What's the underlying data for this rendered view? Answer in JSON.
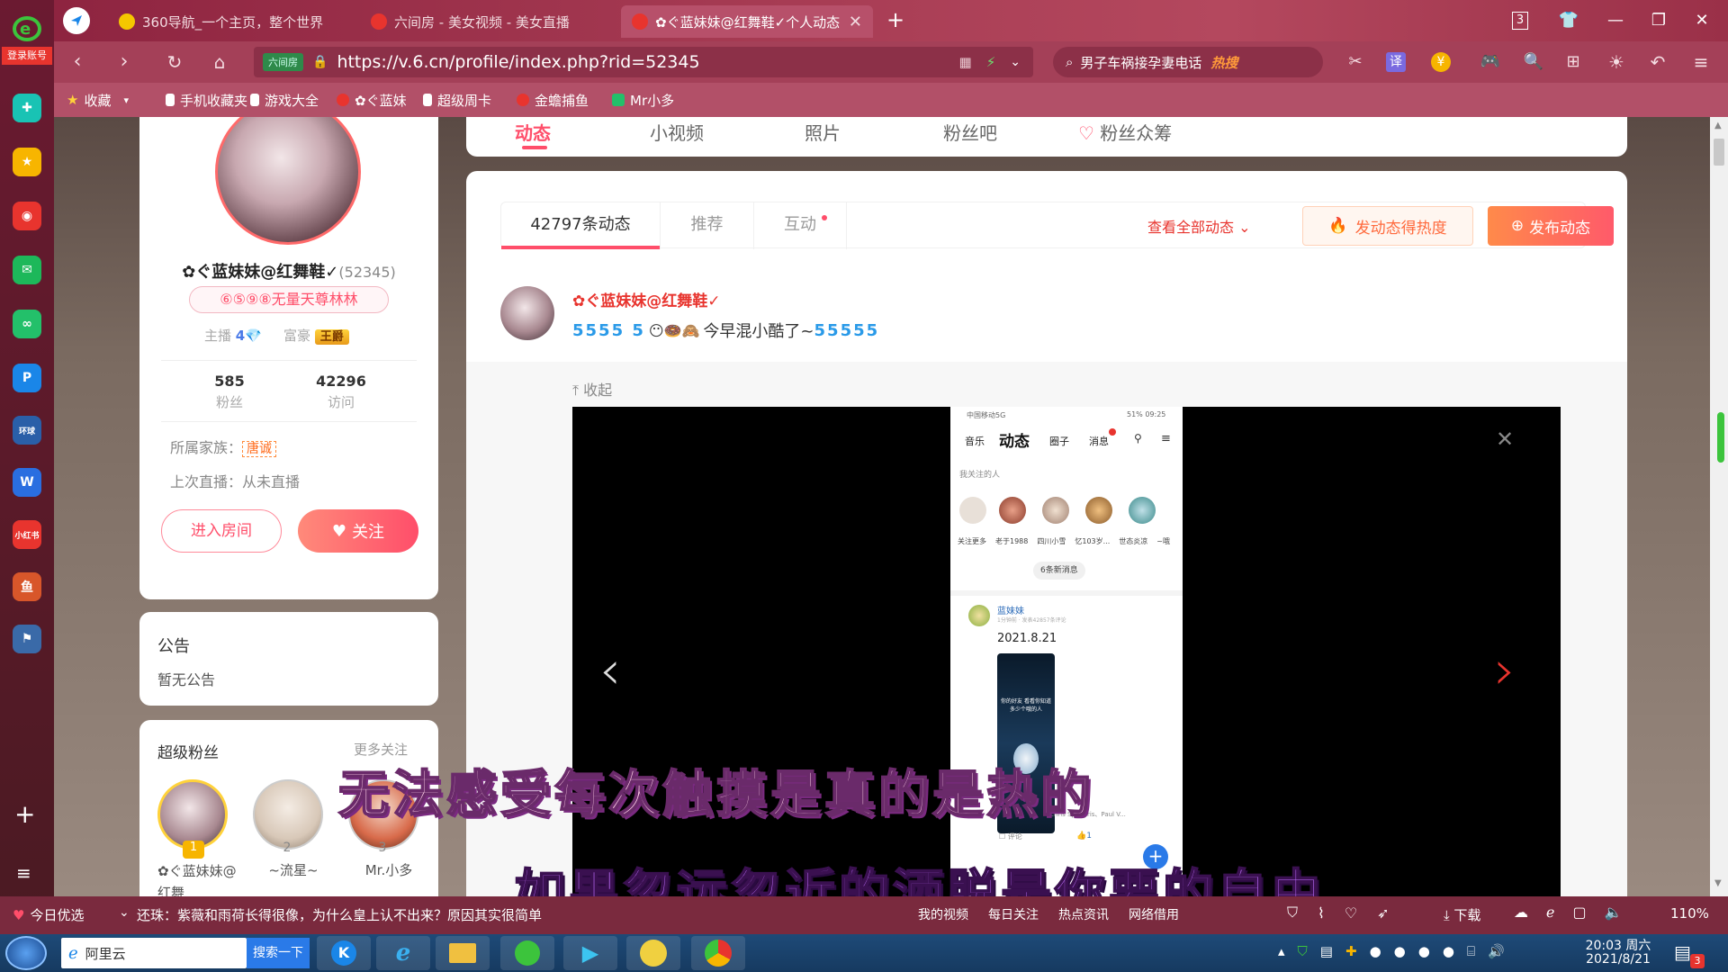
{
  "browser": {
    "login_label": "登录账号",
    "tabs": [
      {
        "label": "360导航_一个主页，整个世界",
        "active": false
      },
      {
        "label": "六间房 - 美女视频 - 美女直播",
        "active": false
      },
      {
        "label": "✿ぐ蓝妹妹@红舞鞋✓个人动态",
        "active": true
      }
    ],
    "tab_count": "3",
    "address_badge": "六间房",
    "url": "https://v.6.cn/profile/index.php?rid=52345",
    "search_text": "男子车祸接孕妻电话",
    "search_hot": "热搜",
    "translate_label": "译",
    "bookmarks": [
      "收藏",
      "手机收藏夹",
      "游戏大全",
      "✿ぐ蓝妹",
      "超级周卡",
      "金蟾捕鱼",
      "Mr小多"
    ]
  },
  "profile_tabs": [
    "动态",
    "小视频",
    "照片",
    "粉丝吧",
    "粉丝众筹"
  ],
  "profile": {
    "name": "✿ぐ蓝妹妹@红舞鞋✓",
    "rid": "(52345)",
    "badge": "⑥⑤⑨⑧无量天尊林林",
    "anchor_label": "主播",
    "anchor_level": "4",
    "rich_label": "富豪",
    "rich_level": "王爵",
    "fans_count": "585",
    "fans_label": "粉丝",
    "visits_count": "42296",
    "visits_label": "访问",
    "family_label": "所属家族：",
    "family_value": "唐诚",
    "last_live": "上次直播：从未直播",
    "enter_room": "进入房间",
    "follow": "关注"
  },
  "notice": {
    "title": "公告",
    "text": "暂无公告"
  },
  "superfans": {
    "title": "超级粉丝",
    "more": "更多关注",
    "fans": [
      {
        "rank": "1",
        "name": "✿ぐ蓝妹妹@红舞"
      },
      {
        "rank": "2",
        "name": "~流星~"
      },
      {
        "rank": "3",
        "name": "Mr.小多"
      }
    ]
  },
  "feed": {
    "tabs": [
      "42797条动态",
      "推荐",
      "互动"
    ],
    "view_all": "查看全部动态",
    "hot_button": "发动态得热度",
    "publish_button": "发布动态",
    "post_author": "✿ぐ蓝妹妹@红舞鞋✓",
    "post_text": "今早混小酷了~",
    "collapse": "收起"
  },
  "phone": {
    "status_left": "中国移动5G",
    "status_right": "51% 09:25",
    "tabs": [
      "音乐",
      "动态",
      "圈子",
      "消息"
    ],
    "following_label": "我关注的人",
    "following": [
      "关注更多",
      "老于1988",
      "四川小雪",
      "忆103岁...",
      "世态炎凉",
      "~哦"
    ],
    "new_msg": "6条新消息",
    "post_name": "蓝妹妹",
    "post_meta": "1分钟前 · 发表42857条评论",
    "post_date": "2021.8.21",
    "video_caption": "你的好友 看看你知道多少个哦的人",
    "music": "Chris Spheeris、Paul V...",
    "comment": "评论",
    "likes": "1"
  },
  "subtitles": [
    "无法感受每次触摸是真的是热的",
    "如果忽远忽近的洒脱是你要的自由"
  ],
  "statusbar": {
    "today": "今日优选",
    "news": "还珠：紫薇和雨荷长得很像，为什么皇上认不出来？原因其实很简单",
    "items": [
      "我的视频",
      "每日关注",
      "热点资讯",
      "网络借用"
    ],
    "download": "下载",
    "zoom": "110%"
  },
  "taskbar": {
    "app_label": "阿里云",
    "search_btn": "搜索一下",
    "time": "20:03 周六",
    "date": "2021/8/21",
    "badge": "3"
  },
  "colors": {
    "accent": "#ff4e6a",
    "orange": "#ff6a3d",
    "brand": "#e8342e"
  }
}
